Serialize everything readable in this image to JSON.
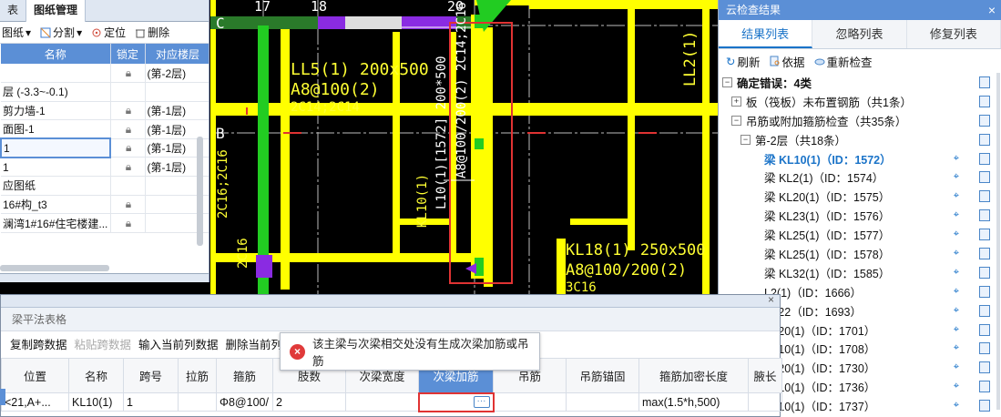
{
  "left_panel": {
    "tabs": [
      "表",
      "图纸管理"
    ],
    "toolbar": [
      "图纸",
      "分割",
      "定位",
      "删除"
    ],
    "columns": [
      "名称",
      "锁定",
      "对应楼层"
    ],
    "rows": [
      {
        "name": "层 (-3.3~-0.1)",
        "locked": false,
        "floor": ""
      },
      {
        "name": "剪力墙-1",
        "locked": true,
        "floor": "(第-1层)"
      },
      {
        "name": "面图-1",
        "locked": true,
        "floor": "(第-1层)"
      },
      {
        "name": "1",
        "locked": true,
        "floor": "(第-1层)",
        "selected": true
      },
      {
        "name": "1",
        "locked": true,
        "floor": "(第-1层)"
      },
      {
        "name": "应图纸",
        "locked": false,
        "floor": ""
      },
      {
        "name": "16#构_t3",
        "locked": true,
        "floor": ""
      },
      {
        "name": "澜湾1#16#住宅楼建...",
        "locked": true,
        "floor": ""
      }
    ],
    "first_row_floor": "(第-2层)"
  },
  "cad": {
    "axis_labels": [
      "C",
      "17",
      "18",
      "20",
      "B"
    ],
    "annotations": {
      "ll5": "LL5(1) 200x500",
      "ll5_stirrup": "A8@100(2)",
      "ll5_bottom": "2C14;2C14",
      "kl10_vertical": "KL10(1)",
      "kl10_detail": "L10(1)[1572] 200*500",
      "kl10_stirrup": "A8@100/200(2) 2C14;2C16",
      "ll2": "LL2(1)",
      "kl18": "KL18(1) 250x500",
      "kl18_stirrup": "A8@100/200(2)",
      "kl18_bottom": "3C16",
      "left_vert": "2C16;2C16",
      "left_c16": "2C16"
    }
  },
  "right_panel": {
    "title": "云检查结果",
    "tabs": [
      "结果列表",
      "忽略列表",
      "修复列表"
    ],
    "toolbar": [
      "刷新",
      "依据",
      "重新检查"
    ],
    "tree": [
      {
        "level": 0,
        "text": "确定错误：4类",
        "expander": "−",
        "bold": true
      },
      {
        "level": 1,
        "text": "板（筏板）未布置钢筋（共1条）",
        "expander": "+"
      },
      {
        "level": 1,
        "text": "吊筋或附加箍筋检查（共35条）",
        "expander": "−"
      },
      {
        "level": 2,
        "text": "第-2层（共18条）",
        "expander": "−"
      },
      {
        "level": 3,
        "text": "梁 KL10(1)（ID：1572）",
        "active": true
      },
      {
        "level": 3,
        "text": "梁 KL2(1)（ID：1574）"
      },
      {
        "level": 3,
        "text": "梁 KL20(1)（ID：1575）"
      },
      {
        "level": 3,
        "text": "梁 KL23(1)（ID：1576）"
      },
      {
        "level": 3,
        "text": "梁 KL25(1)（ID：1577）"
      },
      {
        "level": 3,
        "text": "梁 KL25(1)（ID：1578）"
      },
      {
        "level": 3,
        "text": "梁 KL32(1)（ID：1585）"
      },
      {
        "level": 3,
        "text": "L2(1)（ID：1666）"
      },
      {
        "level": 3,
        "text": "KL22（ID：1693）"
      },
      {
        "level": 3,
        "text": "KL20(1)（ID：1701）"
      },
      {
        "level": 3,
        "text": "KL10(1)（ID：1708）"
      },
      {
        "level": 3,
        "text": "KL20(1)（ID：1730）"
      },
      {
        "level": 3,
        "text": "KL10(1)（ID：1736）"
      },
      {
        "level": 3,
        "text": "KL10(1)（ID：1737）"
      }
    ]
  },
  "beam_dialog": {
    "title": "梁平法表格",
    "toolbar": [
      "复制跨数据",
      "粘贴跨数据",
      "输入当前列数据",
      "删除当前列数据"
    ],
    "disabled_toolbar": [
      false,
      true,
      false,
      false
    ],
    "columns": [
      "位置",
      "名称",
      "跨号",
      "拉筋",
      "箍筋",
      "肢数",
      "次梁宽度",
      "次梁加筋",
      "吊筋",
      "吊筋锚固",
      "箍筋加密长度",
      "腋长"
    ],
    "row": [
      "<21,A+...",
      "KL10(1)",
      "1",
      "",
      "Φ8@100/",
      "2",
      "",
      "",
      "",
      "",
      "max(1.5*h,500)",
      ""
    ],
    "editing_button": "···"
  },
  "tooltip": {
    "icon": "×",
    "message": "该主梁与次梁相交处没有生成次梁加筋或吊筋"
  }
}
